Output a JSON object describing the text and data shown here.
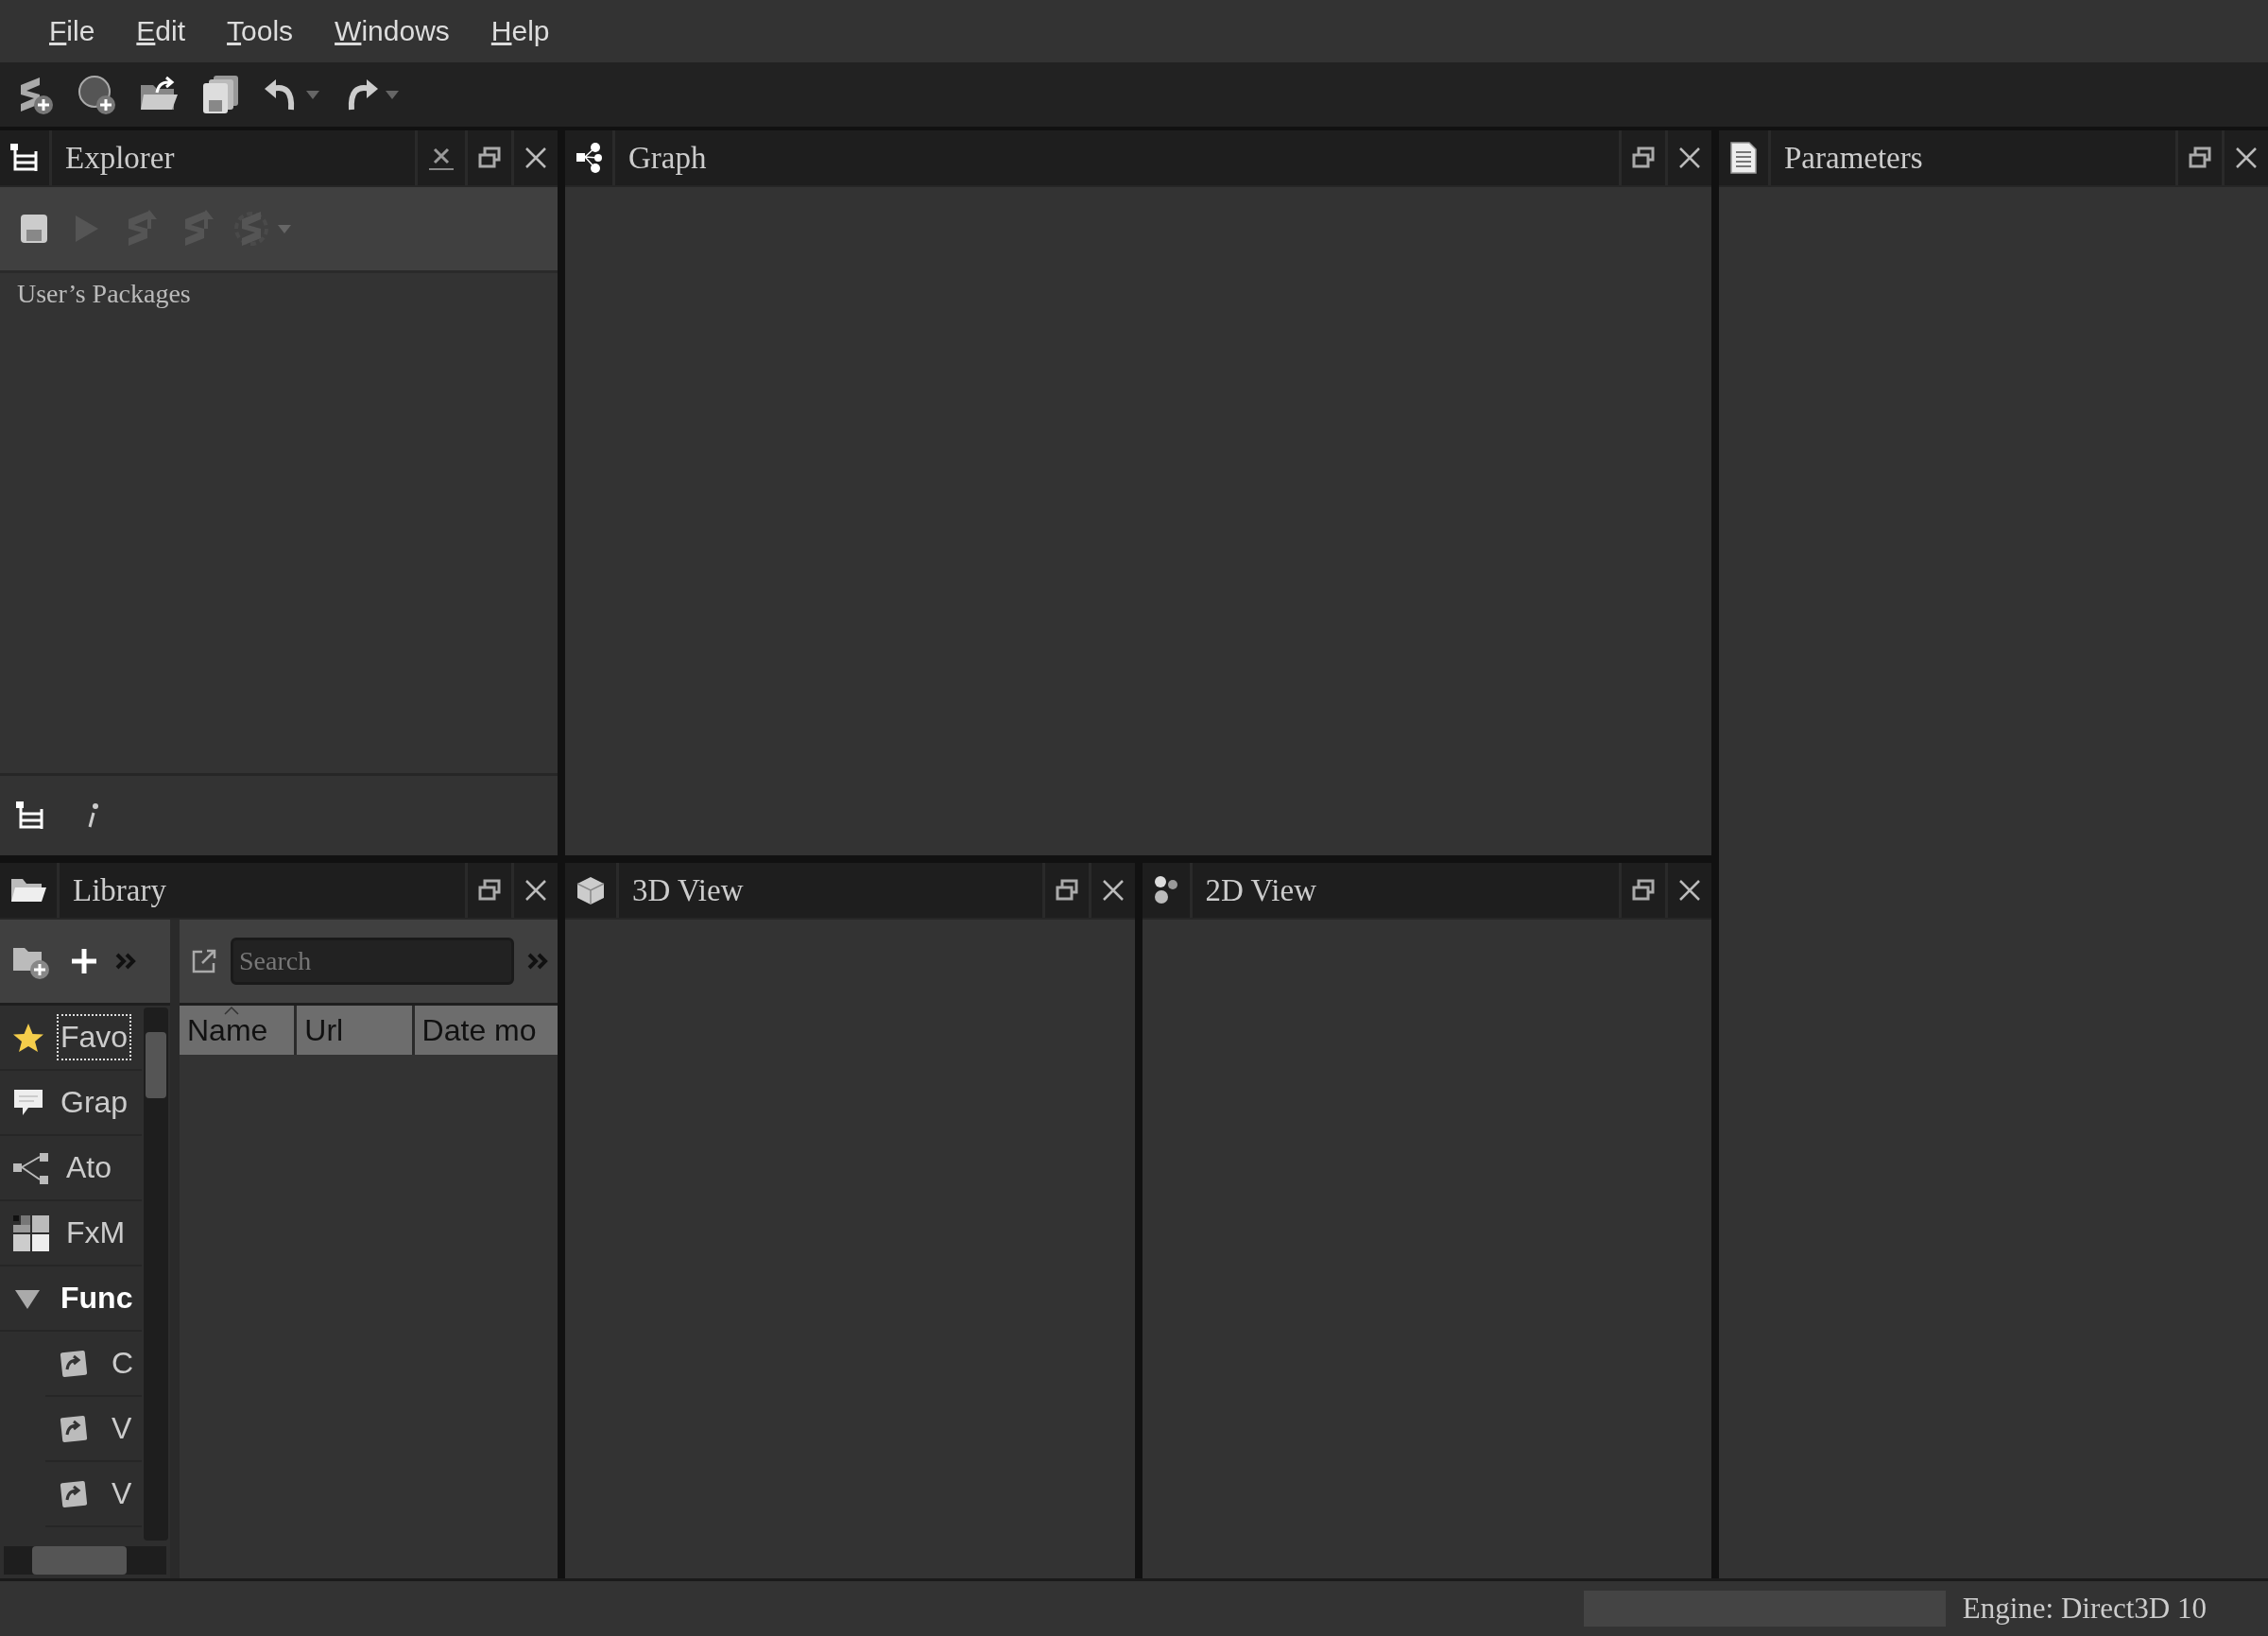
{
  "menu": [
    {
      "label": "File"
    },
    {
      "label": "Edit"
    },
    {
      "label": "Tools"
    },
    {
      "label": "Windows"
    },
    {
      "label": "Help"
    }
  ],
  "explorer": {
    "title": "Explorer",
    "packages": [
      {
        "label": "User’s Packages"
      }
    ]
  },
  "graph": {
    "title": "Graph"
  },
  "parameters": {
    "title": "Parameters"
  },
  "view_3d": {
    "title": "3D View"
  },
  "view_2d": {
    "title": "2D View"
  },
  "library": {
    "title": "Library",
    "search": {
      "placeholder": "Search"
    },
    "categories": [
      {
        "label": "Favo",
        "kind": "item",
        "selected": true
      },
      {
        "label": "Grap",
        "kind": "item",
        "selected": false
      },
      {
        "label": "Ato",
        "kind": "item",
        "selected": false
      },
      {
        "label": "FxM",
        "kind": "item",
        "selected": false
      },
      {
        "label": "Func",
        "kind": "group",
        "selected": false,
        "expanded": true,
        "children": [
          {
            "label": "C",
            "selected": false
          },
          {
            "label": "V",
            "selected": false
          },
          {
            "label": "V",
            "selected": false
          }
        ]
      }
    ],
    "columns": [
      {
        "label": "Name",
        "sorted": true
      },
      {
        "label": "Url",
        "sorted": false
      },
      {
        "label": "Date mo",
        "sorted": false
      }
    ]
  },
  "status_bar": {
    "engine": "Engine: Direct3D 10"
  }
}
